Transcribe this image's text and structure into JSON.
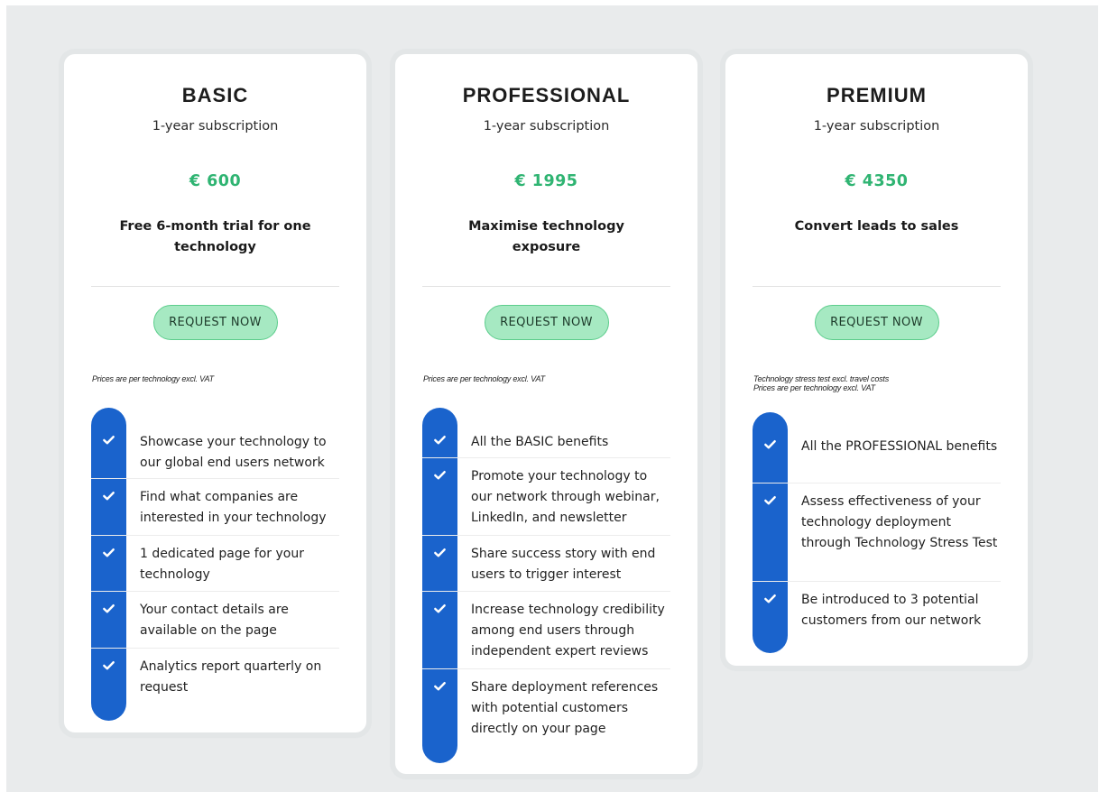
{
  "plans": [
    {
      "name": "BASIC",
      "subtitle": "1-year subscription",
      "price": "€ 600",
      "tagline": "Free 6-month trial for one technology",
      "button_label": "REQUEST NOW",
      "notes": [
        "Prices are per technology excl. VAT"
      ],
      "features": [
        "Showcase your technology to our global end users network",
        "Find what companies are interested in your technology",
        "1 dedicated page for your technology",
        "Your contact details are available on the page",
        "Analytics report quarterly on request"
      ]
    },
    {
      "name": "PROFESSIONAL",
      "subtitle": "1-year subscription",
      "price": "€ 1995",
      "tagline": "Maximise technology exposure",
      "button_label": "REQUEST NOW",
      "notes": [
        "Prices are per technology excl. VAT"
      ],
      "features": [
        "All the BASIC benefits",
        "Promote your technology to our network through webinar, LinkedIn, and newsletter",
        "Share success story with end users to trigger interest",
        "Increase technology credibility among end users through independent expert reviews",
        "Share deployment references with potential customers directly on your page"
      ]
    },
    {
      "name": "PREMIUM",
      "subtitle": "1-year subscription",
      "price": "€ 4350",
      "tagline": "Convert leads to sales",
      "button_label": "REQUEST NOW",
      "notes": [
        "Technology stress test excl. travel costs",
        "Prices are per technology excl. VAT"
      ],
      "features": [
        "All the PROFESSIONAL benefits",
        "Assess effectiveness of your technology deployment through Technology Stress Test",
        "Be introduced to 3 potential customers from our network"
      ]
    }
  ],
  "colors": {
    "price": "#2fb472",
    "button_bg": "#a6e9c2",
    "button_border": "#5ccd8c",
    "feature_bar": "#1a63cc",
    "background": "#e9ebec"
  },
  "icons": {
    "feature_check": "check-icon"
  }
}
